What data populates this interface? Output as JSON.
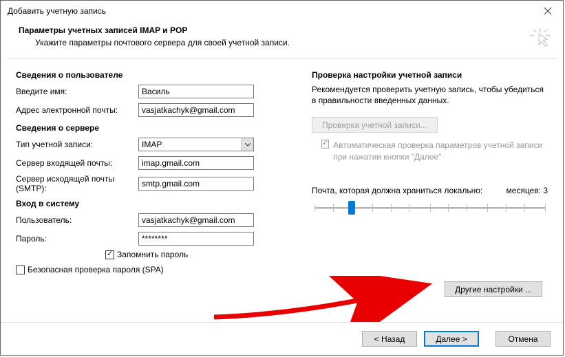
{
  "window": {
    "title": "Добавить учетную запись"
  },
  "header": {
    "title": "Параметры учетных записей IMAP и POP",
    "subtitle": "Укажите параметры почтового сервера для своей учетной записи."
  },
  "left": {
    "user_section": "Сведения о пользователе",
    "name_label": "Введите имя:",
    "name_value": "Василь",
    "email_label": "Адрес электронной почты:",
    "email_value": "vasjatkachyk@gmail.com",
    "server_section": "Сведения о сервере",
    "acct_type_label": "Тип учетной записи:",
    "acct_type_value": "IMAP",
    "incoming_label": "Сервер входящей почты:",
    "incoming_value": "imap.gmail.com",
    "outgoing_label": "Сервер исходящей почты (SMTP):",
    "outgoing_value": "smtp.gmail.com",
    "login_section": "Вход в систему",
    "user_label": "Пользователь:",
    "user_value": "vasjatkachyk@gmail.com",
    "password_label": "Пароль:",
    "password_value": "********",
    "remember_label": "Запомнить пароль",
    "spa_label": "Безопасная проверка пароля (SPA)"
  },
  "right": {
    "test_section": "Проверка настройки учетной записи",
    "test_desc": "Рекомендуется проверить учетную запись, чтобы убедиться в правильности введенных данных.",
    "test_button": "Проверка учетной записи...",
    "autocheck": "Автоматическая проверка параметров учетной записи при нажатии кнопки \"Далее\"",
    "slider_label": "Почта, которая должна храниться локально:",
    "slider_value_label": "месяцев: 3",
    "slider_left": "",
    "slider_right": "",
    "more_button": "Другие настройки ..."
  },
  "footer": {
    "back": "< Назад",
    "next": "Далее >",
    "cancel": "Отмена"
  }
}
